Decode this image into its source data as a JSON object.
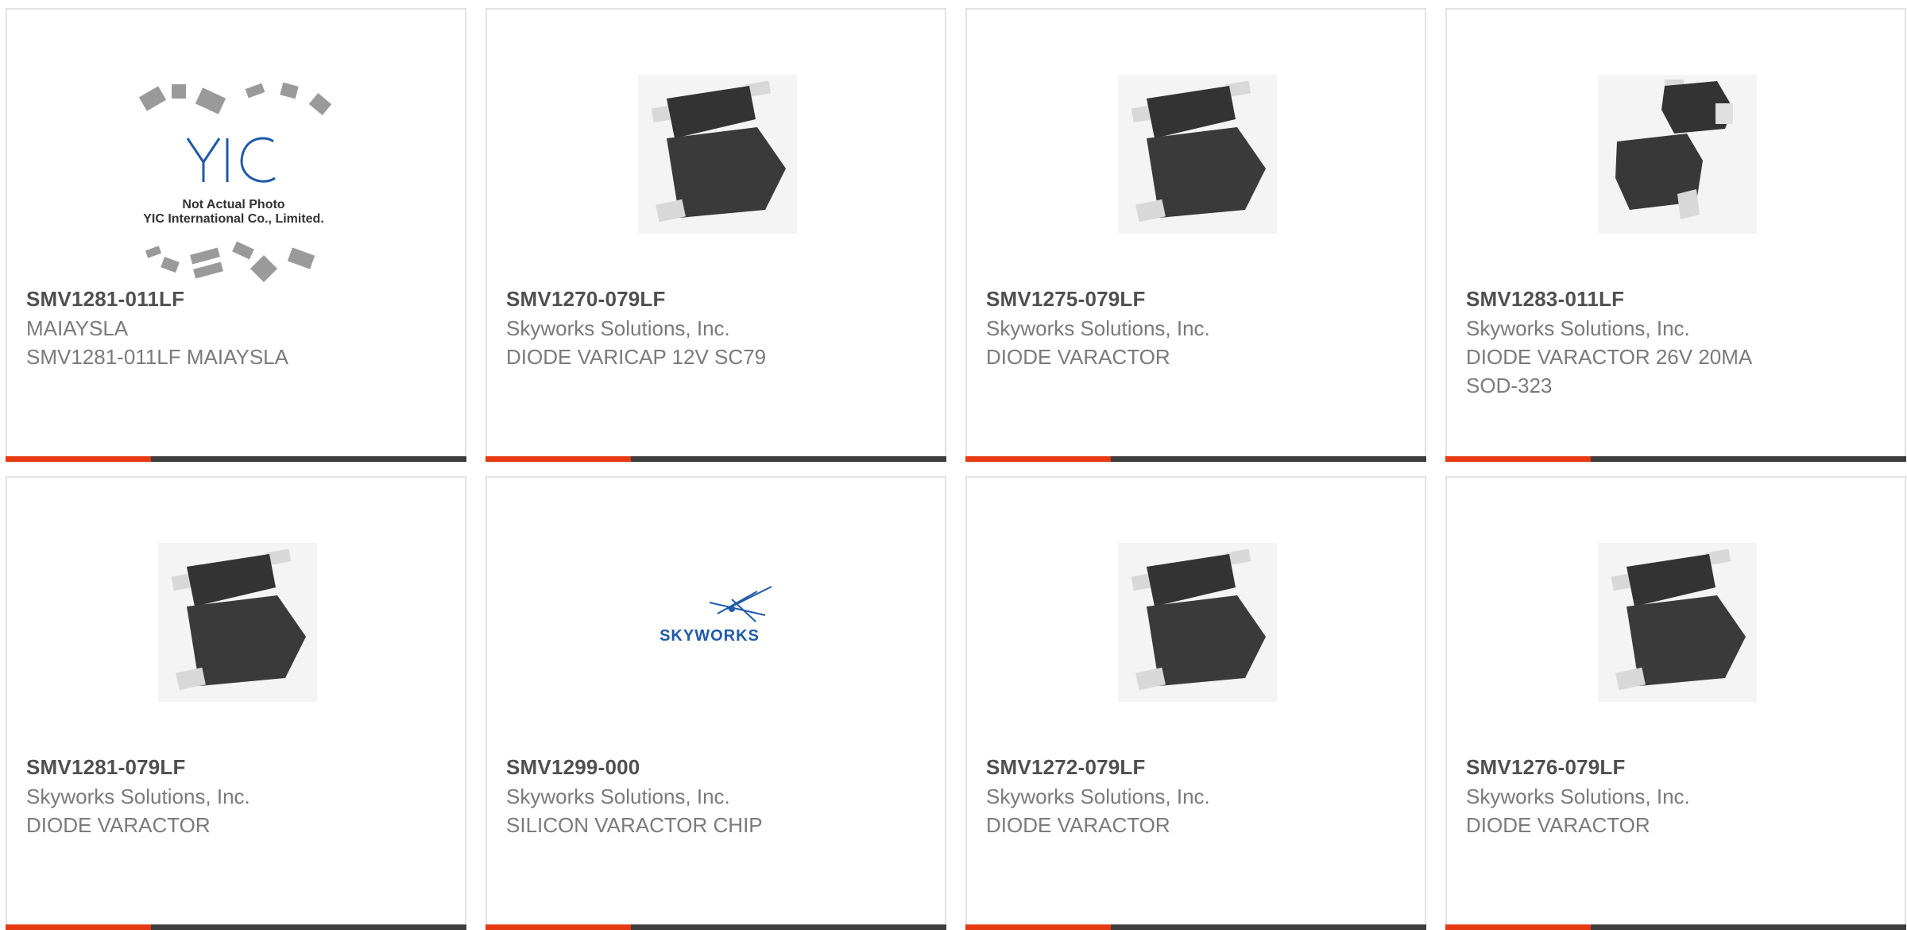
{
  "products": [
    {
      "part_number": "SMV1281-011LF",
      "manufacturer": "MAIAYSLA",
      "description": "SMV1281-011LF MAIAYSLA",
      "image": "yic-placeholder",
      "placeholder": {
        "brand": "YIC",
        "line1": "Not Actual Photo",
        "line2": "YIC International Co., Limited."
      }
    },
    {
      "part_number": "SMV1270-079LF",
      "manufacturer": "Skyworks Solutions, Inc.",
      "description": "DIODE VARICAP 12V SC79",
      "image": "sc79-package"
    },
    {
      "part_number": "SMV1275-079LF",
      "manufacturer": "Skyworks Solutions, Inc.",
      "description": "DIODE VARACTOR",
      "image": "sc79-package"
    },
    {
      "part_number": "SMV1283-011LF",
      "manufacturer": "Skyworks Solutions, Inc.",
      "description": "DIODE VARACTOR 26V 20MA SOD-323",
      "image": "sod323-package"
    },
    {
      "part_number": "SMV1281-079LF",
      "manufacturer": "Skyworks Solutions, Inc.",
      "description": "DIODE VARACTOR",
      "image": "sc79-package"
    },
    {
      "part_number": "SMV1299-000",
      "manufacturer": "Skyworks Solutions, Inc.",
      "description": "SILICON VARACTOR CHIP",
      "image": "skyworks-logo",
      "logo_text": "SKYWORKS"
    },
    {
      "part_number": "SMV1272-079LF",
      "manufacturer": "Skyworks Solutions, Inc.",
      "description": "DIODE VARACTOR",
      "image": "sc79-package"
    },
    {
      "part_number": "SMV1276-079LF",
      "manufacturer": "Skyworks Solutions, Inc.",
      "description": "DIODE VARACTOR",
      "image": "sc79-package"
    }
  ],
  "colors": {
    "accent": "#e63a12",
    "bar": "#3d3d3d",
    "part_number": "#4f4f4f",
    "secondary_text": "#7a7a7a",
    "logo_blue": "#1f5aa6"
  }
}
